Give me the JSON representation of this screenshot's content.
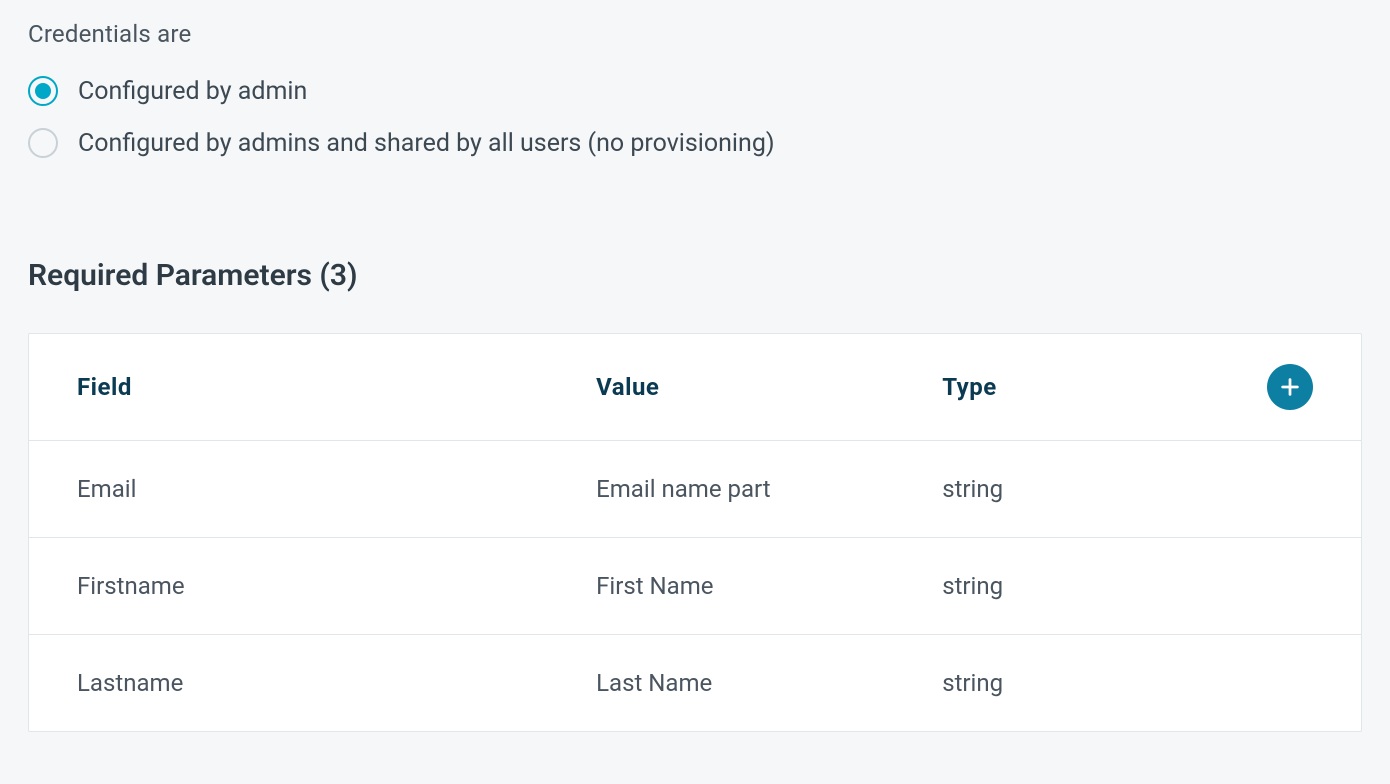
{
  "credentials": {
    "label": "Credentials are",
    "options": [
      {
        "label": "Configured by admin",
        "selected": true
      },
      {
        "label": "Configured by admins and shared by all users (no provisioning)",
        "selected": false
      }
    ]
  },
  "parameters": {
    "heading": "Required Parameters (3)",
    "headers": {
      "field": "Field",
      "value": "Value",
      "type": "Type"
    },
    "rows": [
      {
        "field": "Email",
        "value": "Email name part",
        "type": "string"
      },
      {
        "field": "Firstname",
        "value": "First Name",
        "type": "string"
      },
      {
        "field": "Lastname",
        "value": "Last Name",
        "type": "string"
      }
    ]
  }
}
